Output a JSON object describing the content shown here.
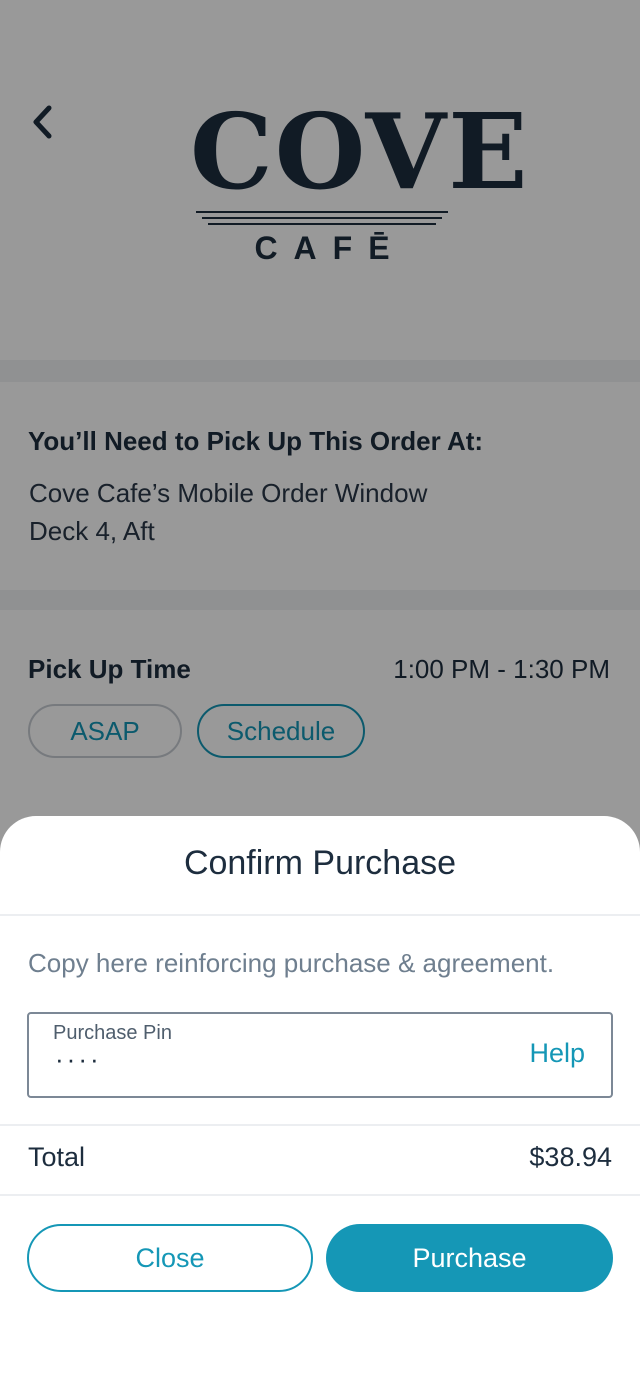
{
  "header": {
    "logo_word": "COVE",
    "logo_sub": "CAFĒ",
    "back_icon": "chevron-left-icon"
  },
  "pickup": {
    "heading": "You’ll Need to Pick Up This Order At:",
    "location_line1": "Cove Cafe’s Mobile Order Window",
    "location_line2": "Deck 4, Aft"
  },
  "pickup_time": {
    "label": "Pick Up Time",
    "value": "1:00 PM - 1:30 PM",
    "options": [
      {
        "label": "ASAP",
        "selected": false
      },
      {
        "label": "Schedule",
        "selected": true
      }
    ]
  },
  "sheet": {
    "title": "Confirm Purchase",
    "copy": "Copy here reinforcing purchase & agreement.",
    "pin_label": "Purchase Pin",
    "pin_value": "····",
    "help_label": "Help",
    "total_label": "Total",
    "total_value": "$38.94",
    "close_label": "Close",
    "purchase_label": "Purchase"
  },
  "colors": {
    "accent": "#1597b6",
    "text_dark": "#1d2d3e",
    "text_muted": "#6f7f8f",
    "overlay": "rgba(0,0,0,0.4)"
  }
}
